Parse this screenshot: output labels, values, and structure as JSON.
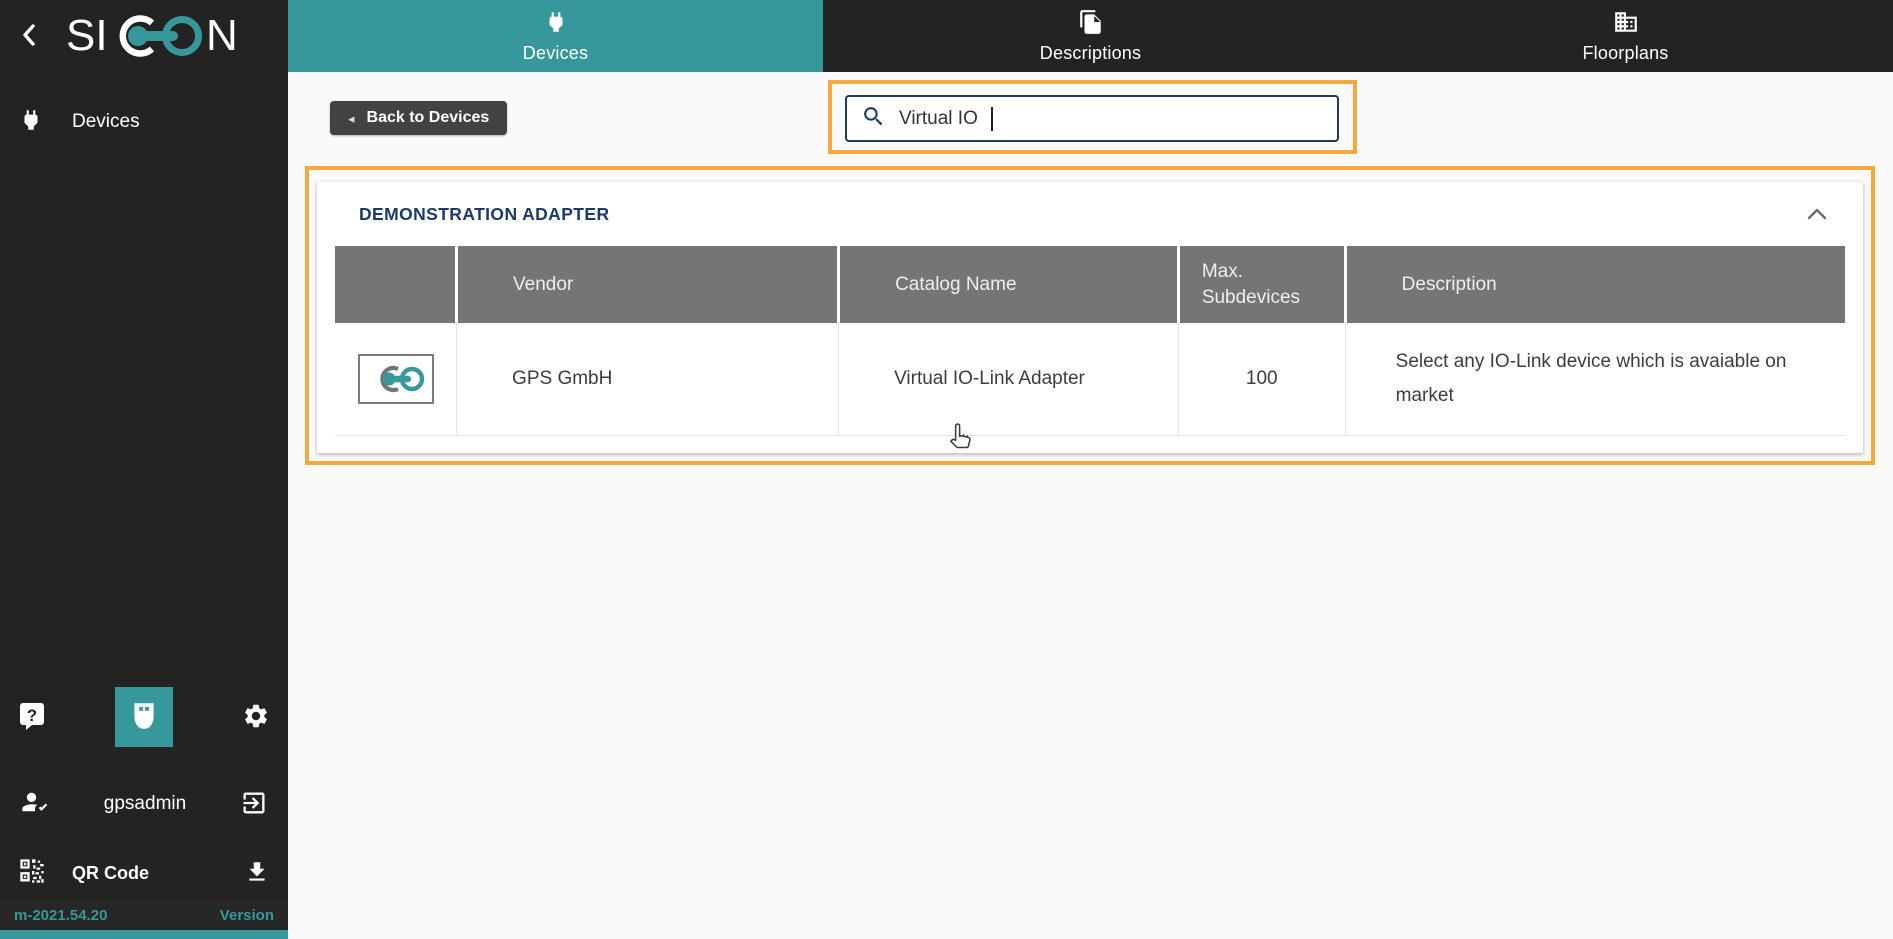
{
  "colors": {
    "accent_teal": "#36989a",
    "navy": "#1b3a64",
    "annotation_orange": "#f6a83d",
    "table_header_gray": "#757575",
    "sidebar_dark": "#232323",
    "button_gray": "#424242"
  },
  "logo": {
    "left": "SI",
    "right": "N"
  },
  "topnav": {
    "tabs": [
      {
        "label": "Devices",
        "icon": "plug-icon",
        "active": true
      },
      {
        "label": "Descriptions",
        "icon": "copy-pages-icon",
        "active": false
      },
      {
        "label": "Floorplans",
        "icon": "building-icon",
        "active": false
      }
    ]
  },
  "sidebar": {
    "nav": [
      {
        "label": "Devices",
        "icon": "plug-icon"
      }
    ],
    "username": "gpsadmin",
    "qr_label": "QR Code",
    "version_number": "m-2021.54.20",
    "version_label": "Version"
  },
  "toolbar": {
    "back_button_label": "Back to Devices"
  },
  "search": {
    "value": "Virtual IO"
  },
  "panel": {
    "title": "DEMONSTRATION ADAPTER"
  },
  "table": {
    "columns": [
      "",
      "Vendor",
      "Catalog Name",
      "Max. Subdevices",
      "Description"
    ],
    "rows": [
      {
        "vendor": "GPS GmbH",
        "catalog_name": "Virtual IO-Link Adapter",
        "max_subdevices": "100",
        "description": "Select any IO-Link device which is avaiable on market"
      }
    ]
  },
  "icons": {
    "sidebar_toggle": "chevron-left-icon",
    "search": "magnifier-icon",
    "help": "help-bubble-icon",
    "usb": "usb-connector-icon",
    "settings": "gear-icon",
    "user": "person-check-icon",
    "logout": "exit-icon",
    "qr": "qr-code-icon",
    "download": "download-icon",
    "collapse_section": "chevron-up-icon",
    "cursor": "hand-cursor"
  }
}
